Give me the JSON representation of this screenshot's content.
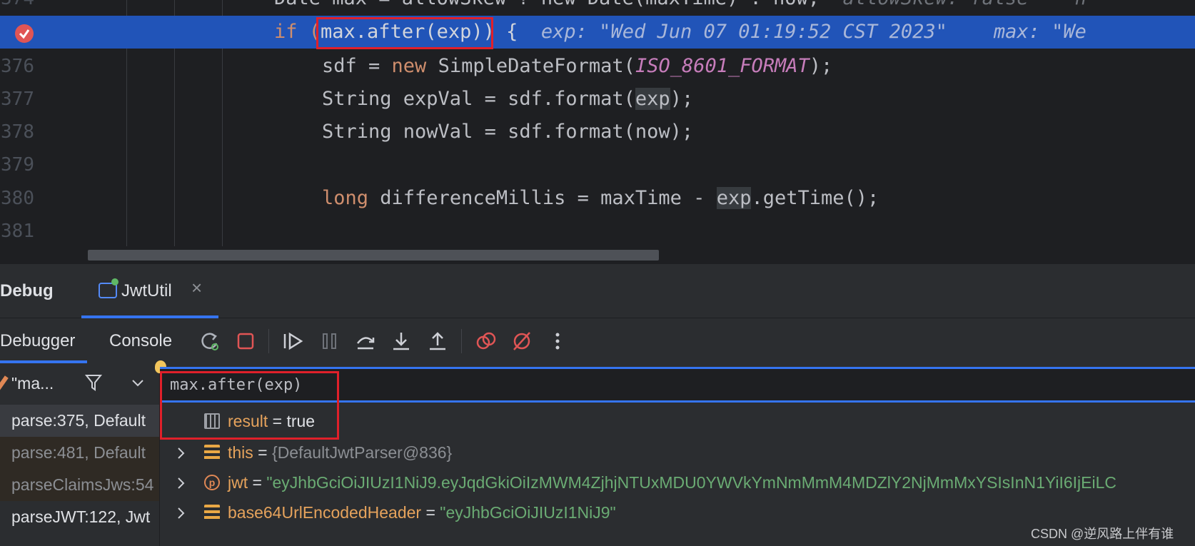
{
  "editor": {
    "lines": [
      {
        "num": "374",
        "code_plain": "Date max = allowSkew ? new Date(maxTime) : now;",
        "hint": "allowSkew: false    n"
      },
      {
        "num": "",
        "code_prefix": "if (",
        "code_expr": "max.after(exp)",
        "code_suffix": ") {",
        "hint": "exp: \"Wed Jun 07 01:19:52 CST 2023\"    max: \"We"
      },
      {
        "num": "376",
        "code_a": "sdf = ",
        "kw": "new",
        "code_b": " SimpleDateFormat(",
        "const": "ISO_8601_FORMAT",
        "code_c": ");"
      },
      {
        "num": "377",
        "code_a": "String expVal = sdf.format(",
        "ref": "exp",
        "code_c": ");"
      },
      {
        "num": "378",
        "code_a": "String nowVal = sdf.format(now);"
      },
      {
        "num": "379"
      },
      {
        "num": "380",
        "kw": "long",
        "code_a": " differenceMillis = maxTime - ",
        "ref": "exp",
        "code_c": ".getTime();"
      },
      {
        "num": "381"
      }
    ],
    "keyword_new": "new",
    "keyword_if": "if"
  },
  "debug": {
    "title": "Debug",
    "tab_label": "JwtUtil",
    "close_glyph": "×",
    "subtabs": [
      "Debugger",
      "Console"
    ],
    "toolbar_icons": [
      "rerun-icon",
      "stop-icon",
      "resume-icon",
      "pause-icon",
      "step-over-icon",
      "step-into-icon",
      "step-out-icon",
      "view-breakpoints-icon",
      "mute-breakpoints-icon",
      "more-icon"
    ],
    "thread_name": "\"ma...",
    "frames": [
      "parse:375, Default",
      "parse:481, Default",
      "parseClaimsJws:54",
      "parseJWT:122, Jwt"
    ],
    "expression": "max.after(exp)",
    "variables": [
      {
        "icon": "calculator-icon",
        "name": "result",
        "eq": " = ",
        "value": "true",
        "kind": "plain",
        "expandable": false
      },
      {
        "icon": "field-icon",
        "name": "this",
        "eq": " = ",
        "value": "{DefaultJwtParser@836}",
        "kind": "obj",
        "expandable": true
      },
      {
        "icon": "parameter-icon",
        "name": "jwt",
        "eq": " = ",
        "value": "\"eyJhbGciOiJIUzI1NiJ9.eyJqdGkiOiIzMWM4ZjhjNTUxMDU0YWVkYmNmMmM4MDZlY2NjMmMxYSIsInN1YiI6IjEiLC",
        "kind": "str",
        "expandable": true
      },
      {
        "icon": "field-icon",
        "name": "base64UrlEncodedHeader",
        "eq": " = ",
        "value": "\"eyJhbGciOiJIUzI1NiJ9\"",
        "kind": "str",
        "expandable": true
      }
    ]
  },
  "watermark": "CSDN @逆风路上伴有谁",
  "colors": {
    "accent": "#3574f0",
    "current_line": "#2154b8",
    "highlight_box": "#e0202a",
    "string": "#6aab73",
    "keyword": "#cf8e6d"
  }
}
